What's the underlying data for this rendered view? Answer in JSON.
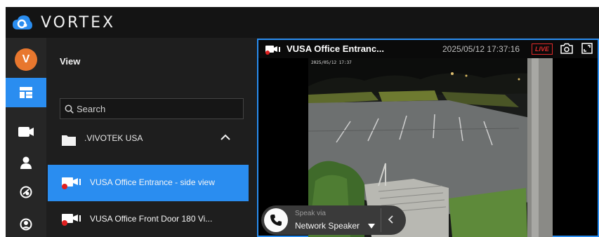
{
  "app": {
    "logo_text": "VORTEX"
  },
  "user": {
    "avatar_initial": "V"
  },
  "sidebar": {
    "title": "View",
    "search_placeholder": "Search",
    "folder": {
      "label": ".VIVOTEK USA",
      "expanded": true
    },
    "cameras": [
      {
        "label": "VUSA Office Entrance - side view",
        "selected": true
      },
      {
        "label": "VUSA Office Front Door 180 Vi...",
        "selected": false
      }
    ]
  },
  "rail": {
    "items": [
      {
        "icon": "layout-icon",
        "active": true
      },
      {
        "icon": "camera-icon",
        "active": false
      },
      {
        "icon": "person-icon",
        "active": false
      },
      {
        "icon": "map-pin-icon",
        "active": false
      },
      {
        "icon": "account-circle-icon",
        "active": false
      }
    ]
  },
  "video": {
    "title": "VUSA Office Entranc...",
    "timestamp": "2025/05/12 17:37:16",
    "live_label": "LIVE",
    "osd_text": "2025/05/12 17:37"
  },
  "speak": {
    "via_label": "Speak via",
    "device": "Network Speaker"
  },
  "colors": {
    "accent": "#2a8df0",
    "live": "#e02b2b",
    "avatar": "#e8772e",
    "camera_red": "#e02020"
  }
}
